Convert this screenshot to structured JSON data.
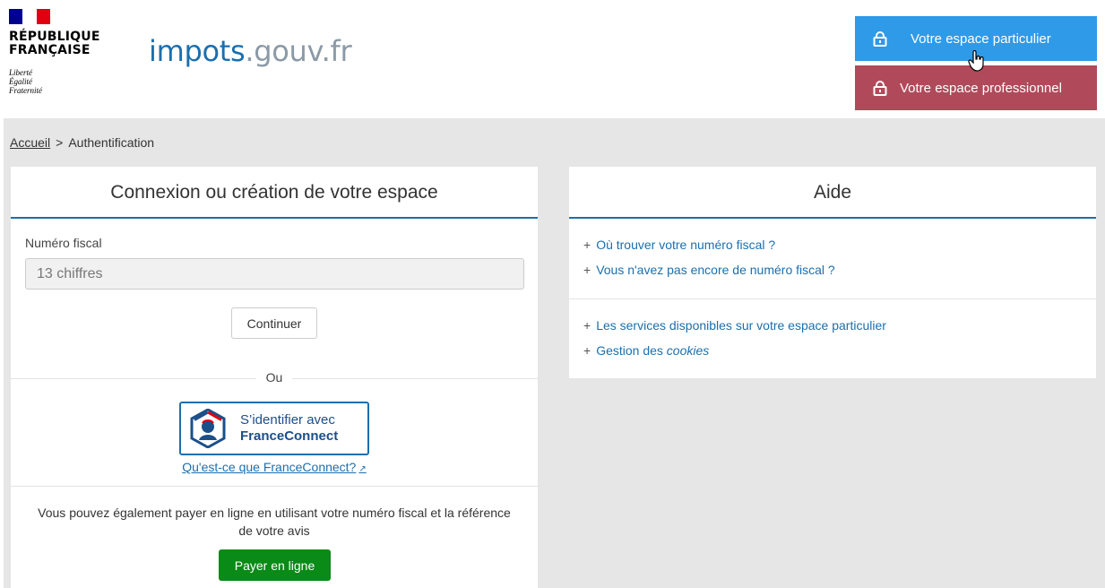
{
  "header": {
    "republic_name_line1": "RÉPUBLIQUE",
    "republic_name_line2": "FRANÇAISE",
    "motto_line1": "Liberté",
    "motto_line2": "Égalité",
    "motto_line3": "Fraternité",
    "site_name_main": "impots",
    "site_name_tld": ".gouv.fr",
    "btn_particulier": "Votre espace particulier",
    "btn_professionnel": "Votre espace professionnel",
    "colors": {
      "particulier": "#2f9ae8",
      "professionnel": "#b04a5a",
      "brand": "#1b6fae"
    }
  },
  "breadcrumb": {
    "home": "Accueil",
    "separator": ">",
    "current": "Authentification"
  },
  "login_panel": {
    "title": "Connexion ou création de votre espace",
    "field_label": "Numéro fiscal",
    "field_placeholder": "13 chiffres",
    "field_value": "",
    "continue_label": "Continuer",
    "or_label": "Ou",
    "fc_line1": "S’identifier avec",
    "fc_line2": "FranceConnect",
    "fc_link": "Qu'est-ce que FranceConnect?",
    "pay_text": "Vous pouvez également payer en ligne en utilisant votre numéro fiscal et la référence de votre avis",
    "pay_button": "Payer en ligne",
    "pay_color": "#0a8a16"
  },
  "help_panel": {
    "title": "Aide",
    "plus": "+",
    "links_group1": [
      {
        "label": "Où trouver votre numéro fiscal ?"
      },
      {
        "label": "Vous n'avez pas encore de numéro fiscal ?"
      }
    ],
    "links_group2": [
      {
        "label": "Les services disponibles sur votre espace particulier"
      },
      {
        "label_prefix": "Gestion des ",
        "label_italic": "cookies"
      }
    ]
  },
  "icons": [
    "lock-icon",
    "lock-icon",
    "hand-pointer-icon",
    "franceconnect-logo-icon",
    "external-link-icon"
  ]
}
